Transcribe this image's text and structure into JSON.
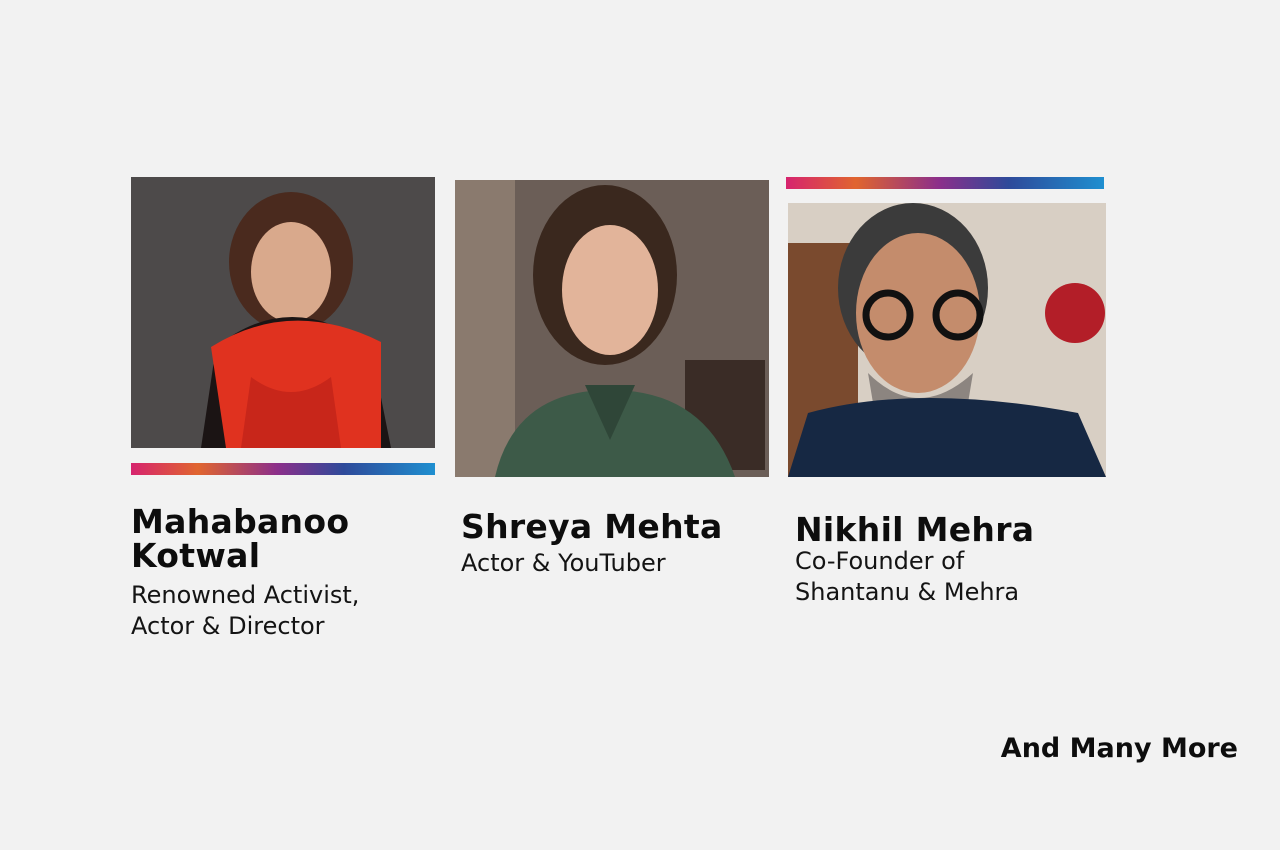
{
  "speakers": [
    {
      "name": "Mahabanoo Kotwal",
      "role": "Renowned Activist,\nActor & Director",
      "photo_icon": "portrait-photo"
    },
    {
      "name": "Shreya Mehta",
      "role": "Actor & YouTuber",
      "photo_icon": "portrait-photo"
    },
    {
      "name": "Nikhil Mehra",
      "role": "Co-Founder of\nShantanu & Mehra",
      "photo_icon": "portrait-photo"
    }
  ],
  "footer": {
    "more_label": "And Many More"
  },
  "colors": {
    "background": "#f2f2f2",
    "gradient": [
      "#d6246e",
      "#e0652f",
      "#8c2f8a",
      "#2e4a9a",
      "#1f8fd0"
    ]
  }
}
